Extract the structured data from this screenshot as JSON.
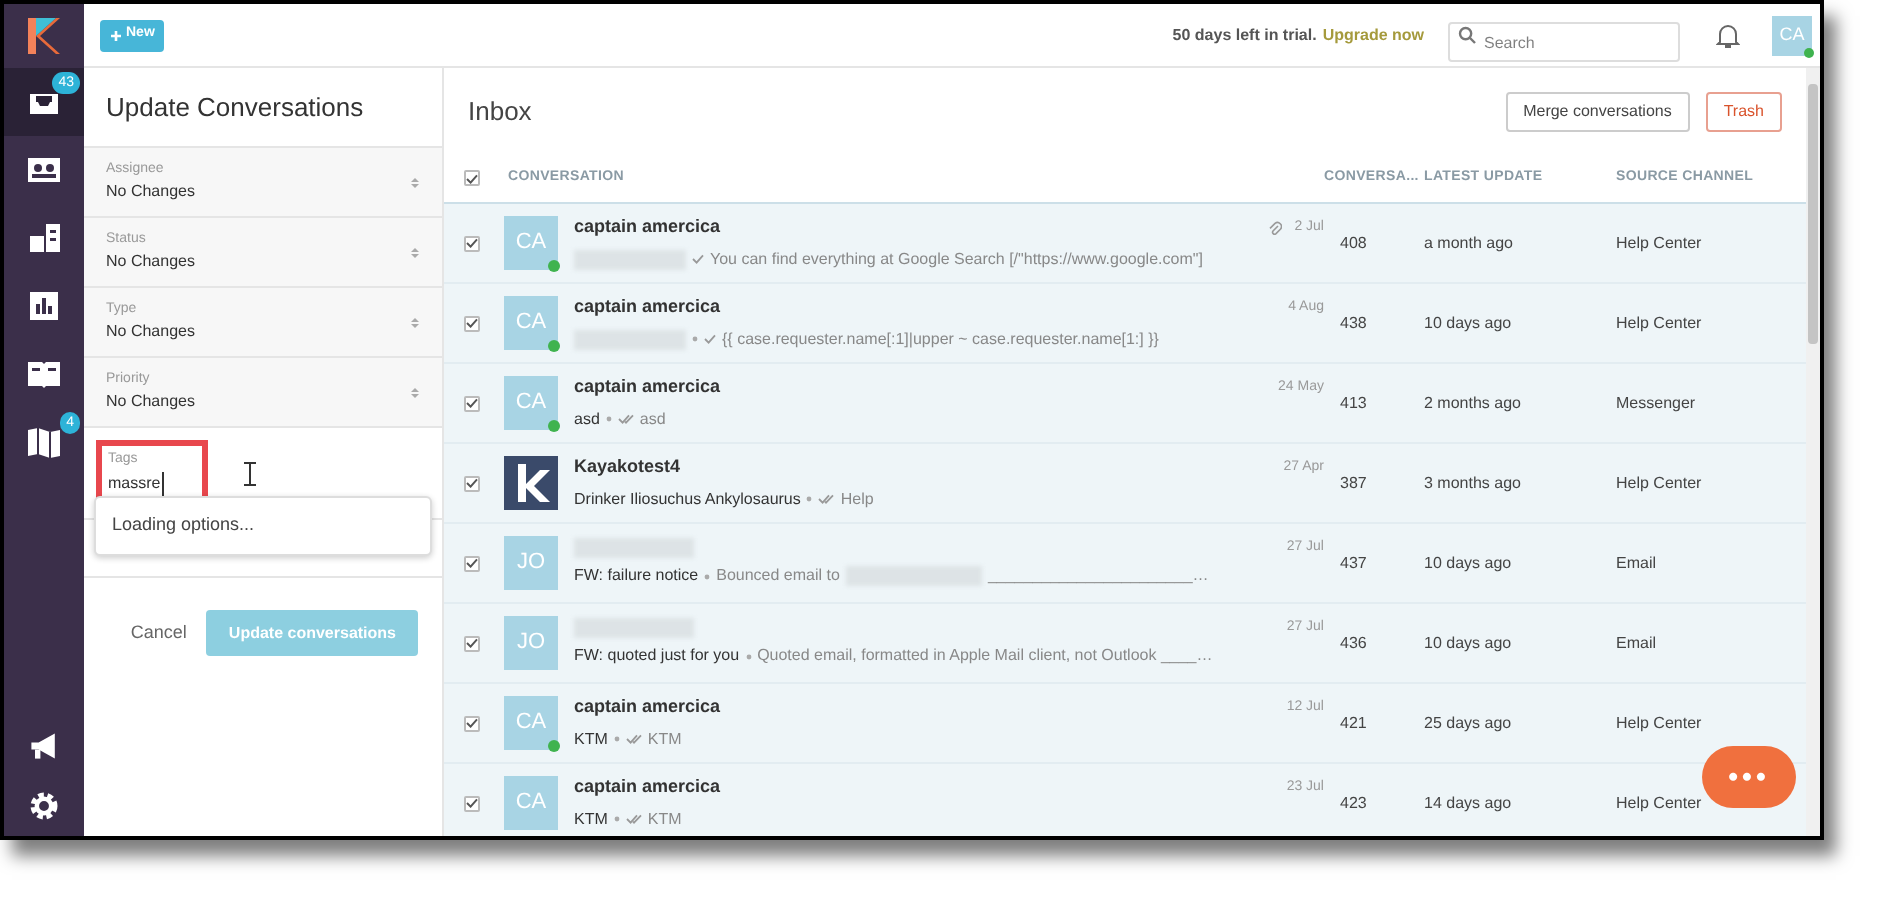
{
  "top_bar": {
    "new_button": "New",
    "trial_text": "50 days left in trial.",
    "upgrade_link": "Upgrade now",
    "search": {
      "placeholder": "Search"
    },
    "user_avatar": "CA",
    "user_online": true
  },
  "sidebar": {
    "items": [
      {
        "kind": "inbox",
        "selected": true,
        "badge": "43"
      },
      {
        "kind": "contacts",
        "selected": false
      },
      {
        "kind": "organizations",
        "selected": false
      },
      {
        "kind": "reports",
        "selected": false
      },
      {
        "kind": "knowledge",
        "selected": false
      },
      {
        "kind": "map",
        "selected": false,
        "badge": "4"
      }
    ],
    "bottom_items": [
      {
        "kind": "megaphone"
      },
      {
        "kind": "settings"
      }
    ]
  },
  "update_panel": {
    "title": "Update Conversations",
    "fields": [
      {
        "label": "Assignee",
        "value": "No Changes"
      },
      {
        "label": "Status",
        "value": "No Changes"
      },
      {
        "label": "Type",
        "value": "No Changes"
      },
      {
        "label": "Priority",
        "value": "No Changes"
      }
    ],
    "tags": {
      "label": "Tags",
      "value": "massre",
      "highlighted": true
    },
    "dropdown": {
      "text": "Loading options..."
    },
    "cancel": "Cancel",
    "submit": {
      "label": "Update conversations",
      "disabled": true
    }
  },
  "inbox": {
    "title": "Inbox",
    "merge_button": "Merge conversations",
    "trash_button": "Trash",
    "all_checked": true,
    "columns": [
      "CONVERSATION",
      "CONVERSA...",
      "LATEST UPDATE",
      "SOURCE CHANNEL"
    ],
    "rows": [
      {
        "selected": true,
        "avatar": {
          "kind": "initials",
          "text": "CA"
        },
        "online": true,
        "name": "captain amercica",
        "name_redacted": false,
        "attachment": true,
        "date": "2 Jul",
        "subject": [
          {
            "kind": "redacted"
          }
        ],
        "bullet": false,
        "receipt": {
          "kind": "single"
        },
        "preview": [
          {
            "kind": "text",
            "text": "You can find everything at Google Search [/\"https://www.google.com\"]"
          }
        ],
        "id": "408",
        "updated": "a month ago",
        "channel": "Help Center"
      },
      {
        "selected": true,
        "avatar": {
          "kind": "initials",
          "text": "CA"
        },
        "online": true,
        "name": "captain amercica",
        "name_redacted": false,
        "attachment": false,
        "date": "4 Aug",
        "subject": [
          {
            "kind": "redacted"
          }
        ],
        "bullet": true,
        "receipt": {
          "kind": "single"
        },
        "preview": [
          {
            "kind": "text",
            "text": "{{ case.requester.name[:1]|upper ~ case.requester.name[1:] }}"
          }
        ],
        "id": "438",
        "updated": "10 days ago",
        "channel": "Help Center"
      },
      {
        "selected": true,
        "avatar": {
          "kind": "initials",
          "text": "CA"
        },
        "online": true,
        "name": "captain amercica",
        "name_redacted": false,
        "attachment": false,
        "date": "24 May",
        "subject": [
          {
            "kind": "text",
            "text": "asd"
          }
        ],
        "bullet": true,
        "receipt": {
          "kind": "double"
        },
        "preview": [
          {
            "kind": "text",
            "text": "asd"
          }
        ],
        "id": "413",
        "updated": "2 months ago",
        "channel": "Messenger"
      },
      {
        "selected": true,
        "avatar": {
          "kind": "logo"
        },
        "online": false,
        "name": "Kayakotest4",
        "name_redacted": false,
        "attachment": false,
        "date": "27 Apr",
        "subject": [
          {
            "kind": "text",
            "text": "Drinker Iliosuchus Ankylosaurus"
          }
        ],
        "bullet": true,
        "receipt": {
          "kind": "double"
        },
        "preview": [
          {
            "kind": "text",
            "text": "Help"
          }
        ],
        "id": "387",
        "updated": "3 months ago",
        "channel": "Help Center"
      },
      {
        "selected": true,
        "avatar": {
          "kind": "initials",
          "text": "JO"
        },
        "online": false,
        "name_redacted": true,
        "attachment": false,
        "date": "27 Jul",
        "subject": [
          {
            "kind": "text",
            "text": "FW: failure notice"
          }
        ],
        "bullet": true,
        "preview": [
          {
            "kind": "text",
            "text": "Bounced email to"
          },
          {
            "kind": "redacted"
          },
          {
            "kind": "text",
            "text": "_______________________…"
          }
        ],
        "id": "437",
        "updated": "10 days ago",
        "channel": "Email"
      },
      {
        "selected": true,
        "avatar": {
          "kind": "initials",
          "text": "JO"
        },
        "online": false,
        "name_redacted": true,
        "attachment": false,
        "date": "27 Jul",
        "subject": [
          {
            "kind": "text",
            "text": "FW: quoted just for you"
          }
        ],
        "bullet": true,
        "preview": [
          {
            "kind": "text",
            "text": "Quoted email, formatted in Apple Mail client, not Outlook ____…"
          }
        ],
        "id": "436",
        "updated": "10 days ago",
        "channel": "Email"
      },
      {
        "selected": true,
        "avatar": {
          "kind": "initials",
          "text": "CA"
        },
        "online": true,
        "name": "captain amercica",
        "name_redacted": false,
        "attachment": false,
        "date": "12 Jul",
        "subject": [
          {
            "kind": "text",
            "text": "KTM"
          }
        ],
        "bullet": true,
        "receipt": {
          "kind": "double"
        },
        "preview": [
          {
            "kind": "text",
            "text": "KTM"
          }
        ],
        "id": "421",
        "updated": "25 days ago",
        "channel": "Help Center"
      },
      {
        "selected": true,
        "avatar": {
          "kind": "initials",
          "text": "CA"
        },
        "online": false,
        "name": "captain amercica",
        "name_redacted": false,
        "attachment": false,
        "date": "23 Jul",
        "subject": [
          {
            "kind": "text",
            "text": "KTM"
          }
        ],
        "bullet": true,
        "receipt": {
          "kind": "double"
        },
        "preview": [
          {
            "kind": "text",
            "text": "KTM"
          }
        ],
        "id": "423",
        "updated": "14 days ago",
        "channel": "Help Center"
      }
    ]
  },
  "chat_button": {
    "label": "•••"
  }
}
